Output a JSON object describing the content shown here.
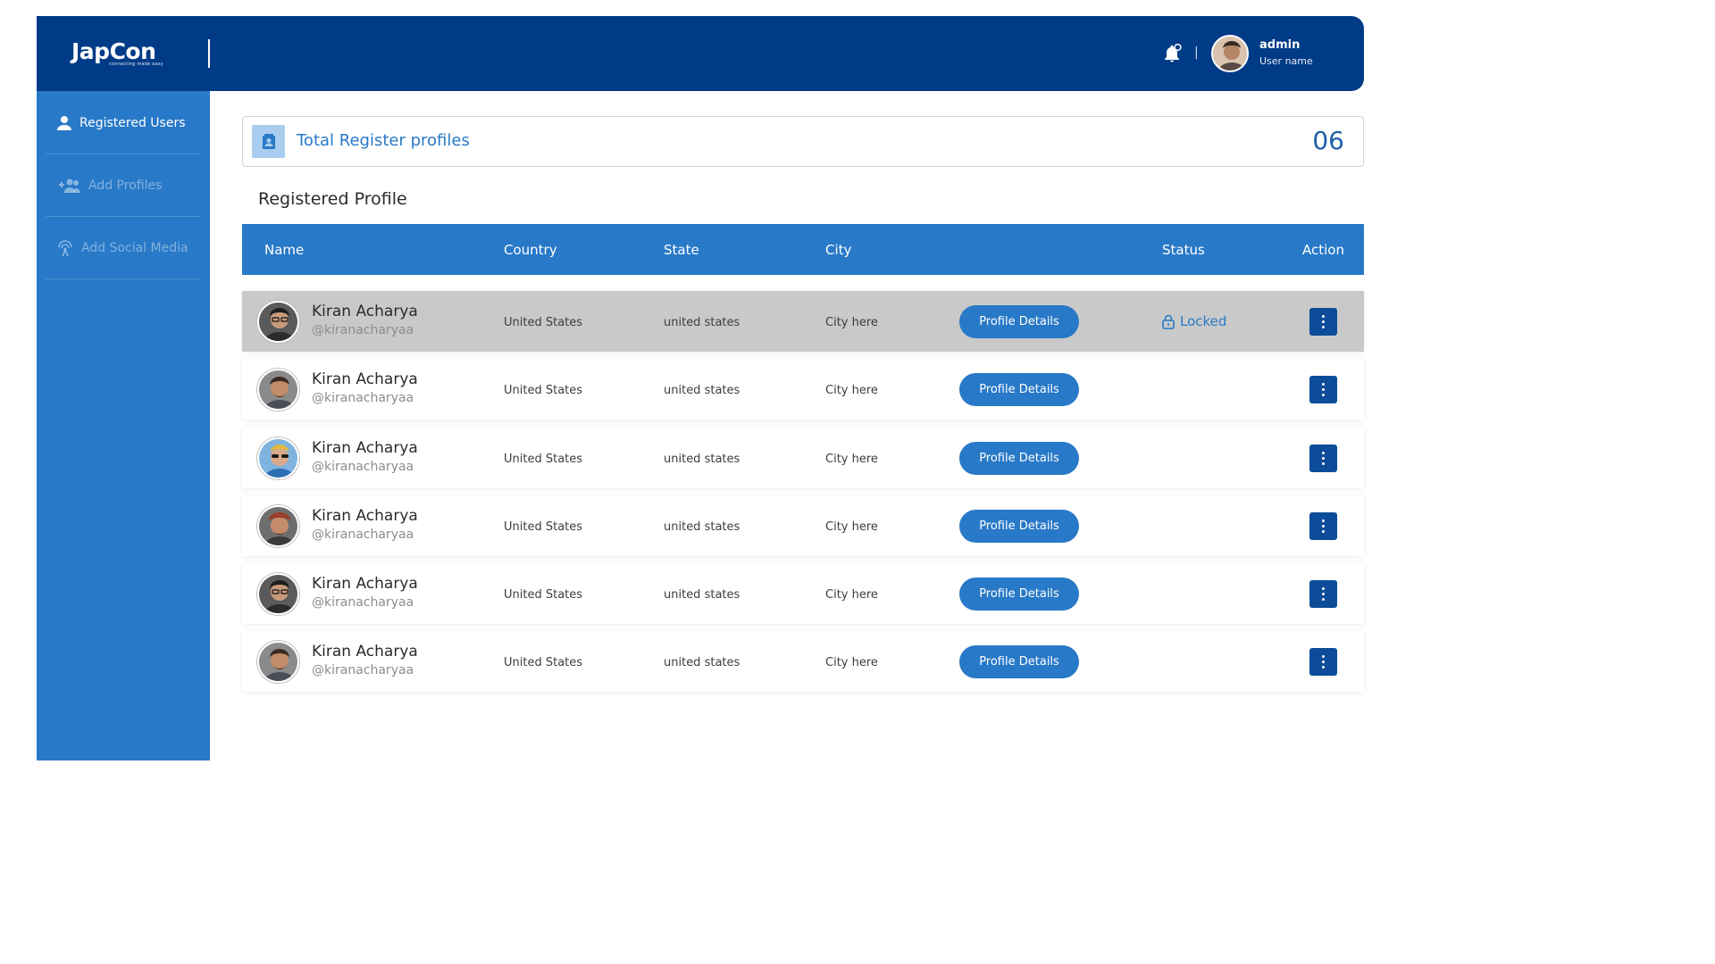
{
  "header": {
    "logo_text": "JapCon",
    "logo_tagline": "connecting made easy",
    "separator": "|",
    "user_name": "admin",
    "user_sub": "User name"
  },
  "sidebar": {
    "items": [
      {
        "label": "Registered Users",
        "icon": "user-icon",
        "active": true
      },
      {
        "label": "Add Profiles",
        "icon": "add-users-icon",
        "active": false
      },
      {
        "label": "Add Social Media",
        "icon": "broadcast-icon",
        "active": false
      }
    ]
  },
  "summary": {
    "label": "Total Register profiles",
    "count": "06"
  },
  "section_title": "Registered Profile",
  "table": {
    "headers": {
      "name": "Name",
      "country": "Country",
      "state": "State",
      "city": "City",
      "status": "Status",
      "action": "Action"
    },
    "rows": [
      {
        "name": "Kiran Acharya",
        "handle": "@kiranacharyaa",
        "country": "United States",
        "state": "united states",
        "city": "City here",
        "button": "Profile Details",
        "status": "Locked"
      },
      {
        "name": "Kiran Acharya",
        "handle": "@kiranacharyaa",
        "country": "United States",
        "state": "united states",
        "city": "City here",
        "button": "Profile Details",
        "status": ""
      },
      {
        "name": "Kiran Acharya",
        "handle": "@kiranacharyaa",
        "country": "United States",
        "state": "united states",
        "city": "City here",
        "button": "Profile Details",
        "status": ""
      },
      {
        "name": "Kiran Acharya",
        "handle": "@kiranacharyaa",
        "country": "United States",
        "state": "united states",
        "city": "City here",
        "button": "Profile Details",
        "status": ""
      },
      {
        "name": "Kiran Acharya",
        "handle": "@kiranacharyaa",
        "country": "United States",
        "state": "united states",
        "city": "City here",
        "button": "Profile Details",
        "status": ""
      },
      {
        "name": "Kiran Acharya",
        "handle": "@kiranacharyaa",
        "country": "United States",
        "state": "united states",
        "city": "City here",
        "button": "Profile Details",
        "status": ""
      }
    ]
  },
  "colors": {
    "header_bg": "#003b87",
    "sidebar_bg": "#2879c7",
    "accent": "#2879c7",
    "kebab_bg": "#0d4c99",
    "highlight_row": "#c9c9c9"
  }
}
